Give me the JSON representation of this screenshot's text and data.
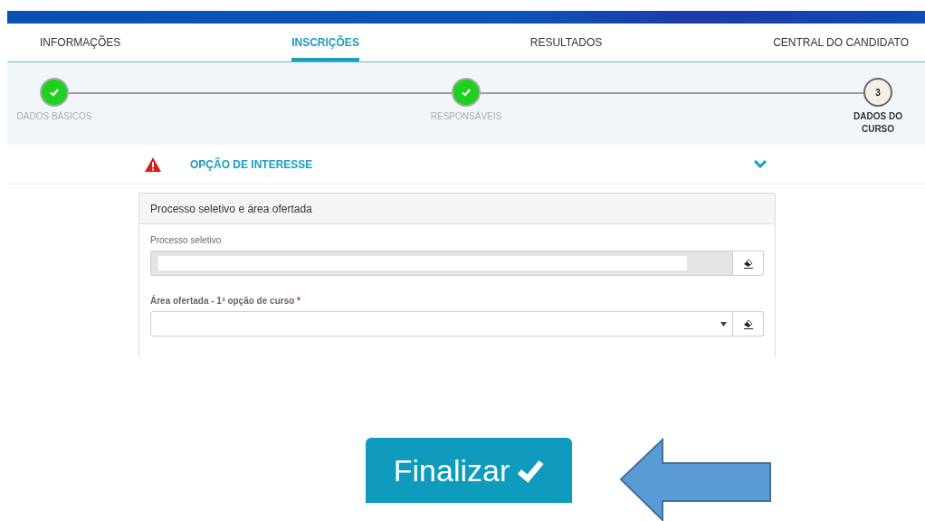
{
  "nav": {
    "tabs": [
      {
        "label": "INFORMAÇÕES",
        "selected": false
      },
      {
        "label": "INSCRIÇÕES",
        "selected": true
      },
      {
        "label": "RESULTADOS",
        "selected": false
      },
      {
        "label": "CENTRAL DO CANDIDATO",
        "selected": false
      }
    ]
  },
  "steps": [
    {
      "label": "DADOS BÁSICOS",
      "done": true
    },
    {
      "label": "RESPONSÁVEIS",
      "done": true
    },
    {
      "label": "DADOS DO CURSO",
      "done": false,
      "number": "3"
    }
  ],
  "section": {
    "title": "OPÇÃO DE INTERESSE",
    "warning": true,
    "expanded": true
  },
  "card": {
    "title": "Processo seletivo e área ofertada",
    "fields": [
      {
        "kind": "text",
        "label": "Processo seletivo",
        "disabled": true
      },
      {
        "kind": "select",
        "label": "Área ofertada - 1ª opção de curso",
        "required_mark": "*",
        "disabled": false
      }
    ]
  },
  "finish_button": {
    "label": "Finalizar"
  }
}
